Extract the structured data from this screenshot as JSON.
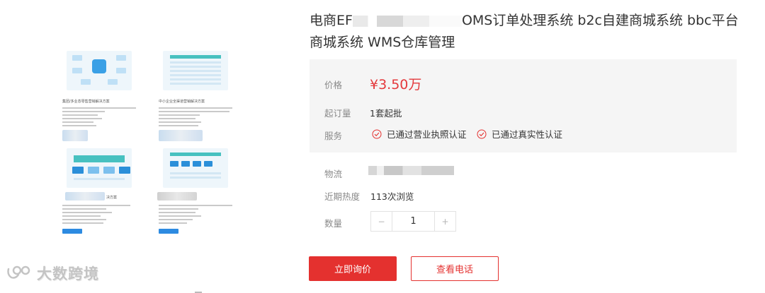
{
  "product": {
    "title_part1": "电商EF",
    "title_part2": "OMS订单处理系统 b2c自建商城系统 bbc平台商城系统 WMS仓库管理"
  },
  "price": {
    "label": "价格",
    "value": "¥3.50万"
  },
  "moq": {
    "label": "起订量",
    "value": "1套起批"
  },
  "service": {
    "label": "服务",
    "items": [
      "已通过营业执照认证",
      "已通过真实性认证"
    ]
  },
  "logistics": {
    "label": "物流"
  },
  "popularity": {
    "label": "近期热度",
    "value": "113次浏览"
  },
  "quantity": {
    "label": "数量",
    "value": "1",
    "minus": "−",
    "plus": "+"
  },
  "actions": {
    "inquire": "立即询价",
    "phone": "查看电话"
  },
  "gallery": {
    "card_titles": [
      "集团/多业态零售营销解决方案",
      "中小企业全渠道营销解决方案",
      "",
      ""
    ],
    "partial_title": "决方案"
  },
  "watermark": {
    "text": "大数跨境"
  },
  "colors": {
    "accent": "#e4312f",
    "price": "#e4393c",
    "panel": "#f5f5f5"
  }
}
